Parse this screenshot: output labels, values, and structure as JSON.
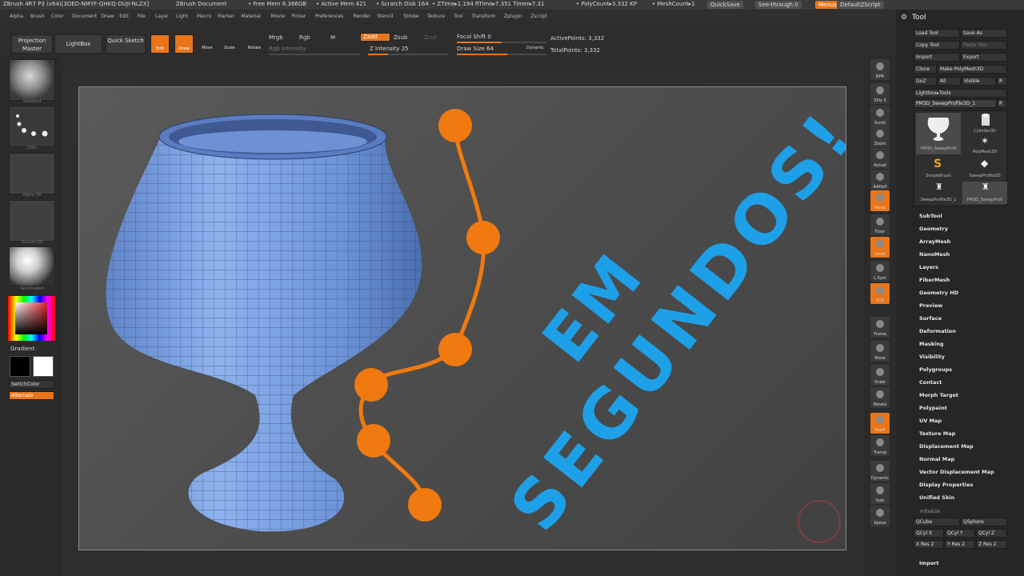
{
  "titlebar": {
    "app": "ZBrush 4R7 P3 (x64)[3DED-NMYF-QHKQ-DUJI-NLZX]",
    "document": "ZBrush Document",
    "free_mem": "• Free Mem 6.366GB",
    "active_mem": "• Active Mem 421",
    "scratch_disk": "• Scratch Disk 164",
    "ztime": "• ZTime▸1.194 RTime▸7.351 Timer▸7.31",
    "polycount": "• PolyCount▸3.332 KP",
    "meshcount": "• MeshCount▸1",
    "quicksave": "QuickSave",
    "seethrough": "See-through  0",
    "menus": "Menus",
    "defaultzscript": "DefaultZScript"
  },
  "menubar": [
    "Alpha",
    "Brush",
    "Color",
    "Document",
    "Draw",
    "Edit",
    "File",
    "Layer",
    "Light",
    "Macro",
    "Marker",
    "Material",
    "Movie",
    "Picker",
    "Preferences",
    "Render",
    "Stencil",
    "Stroke",
    "Texture",
    "Tool",
    "Transform",
    "Zplugin",
    "Zscript"
  ],
  "shelf": {
    "projection_master": "Projection Master",
    "lightbox": "LightBox",
    "quick_sketch": "Quick Sketch",
    "edit": "Edit",
    "draw": "Draw",
    "move": "Move",
    "scale": "Scale",
    "rotate": "Rotate",
    "mrgb": "Mrgb",
    "rgb": "Rgb",
    "m": "M",
    "rgb_intensity": "Rgb Intensity",
    "zadd": "Zadd",
    "zsub": "Zsub",
    "zcut": "Zcut",
    "z_intensity": "Z Intensity 25",
    "z_intensity_value": 25,
    "focal_shift": "Focal Shift 0",
    "focal_shift_value": 0,
    "draw_size": "Draw Size 64",
    "draw_size_value": 64,
    "dynamic": "Dynamic",
    "active_points": "ActivePoints: 3,332",
    "total_points": "TotalPoints: 3,332"
  },
  "left": {
    "standard": "Standard",
    "dots": "Dots",
    "alpha_off": "Alpha Off",
    "texture_off": "Texture Off",
    "skinshade": "SkinShade4",
    "gradient": "Gradient",
    "switchcolor": "SwitchColor",
    "alternate": "Alternate"
  },
  "canvas": {
    "headline_1": "EM",
    "headline_2": "SEGUNDOS!",
    "text_color": "#1ea0e8",
    "curve_color": "#f07a10",
    "mesh_color": "#6f95d6"
  },
  "iconcol": [
    {
      "label": "BPR",
      "active": false
    },
    {
      "label": "SPix 3",
      "active": false
    },
    {
      "label": "Scroll",
      "active": false
    },
    {
      "label": "Zoom",
      "active": false
    },
    {
      "label": "Actual",
      "active": false
    },
    {
      "label": "AAHalf",
      "active": false
    },
    {
      "label": "Persp",
      "active": true
    },
    {
      "label": "Floor",
      "active": false
    },
    {
      "label": "Local",
      "active": true
    },
    {
      "label": "L.Sym",
      "active": false
    },
    {
      "label": "XYZ",
      "active": true
    },
    {
      "label": "Frame",
      "active": false
    },
    {
      "label": "Move",
      "active": false
    },
    {
      "label": "Scale",
      "active": false
    },
    {
      "label": "Rotate",
      "active": false
    },
    {
      "label": "PolyF",
      "active": true
    },
    {
      "label": "Transp",
      "active": false
    },
    {
      "label": "Dynamic",
      "active": false
    },
    {
      "label": "Solo",
      "active": false
    },
    {
      "label": "Xpose",
      "active": false
    }
  ],
  "tool": {
    "title": "Tool",
    "load_tool": "Load Tool",
    "save_as": "Save As",
    "copy_tool": "Copy Tool",
    "paste_tool": "Paste Tool",
    "import": "Import",
    "export": "Export",
    "clone": "Clone",
    "make_polymesh": "Make PolyMesh3D",
    "goz": "GoZ",
    "all": "All",
    "visible": "Visible",
    "r": "R",
    "lightbox_tools": "Lightbox▸Tools",
    "current_tool": "PM3D_SweepProfile3D_1",
    "thumbs": [
      "PM3D_SweepProfi",
      "Cylinder3D",
      "PolyMesh3D",
      "SimpleBrush",
      "SweepProfile3D",
      "SweepProfile3D_1",
      "PM3D_SweepProfi"
    ],
    "sections": [
      "SubTool",
      "Geometry",
      "ArrayMesh",
      "NanoMesh",
      "Layers",
      "FiberMesh",
      "Geometry HD",
      "Preview",
      "Surface",
      "Deformation",
      "Masking",
      "Visibility",
      "Polygroups",
      "Contact",
      "Morph Target",
      "Polypaint",
      "UV Map",
      "Texture Map",
      "Displacement Map",
      "Normal Map",
      "Vector Displacement Map",
      "Display Properties",
      "Unified Skin"
    ],
    "initialize": "Initialize",
    "qcube": "QCube",
    "qsphere": "QSphere",
    "qcyl_x": "QCyl X",
    "qcyl_y": "QCyl Y",
    "qcyl_z": "QCyl Z",
    "x_res": "X Res 2",
    "y_res": "Y Res 2",
    "z_res": "Z Res 2",
    "import2": "Import"
  }
}
